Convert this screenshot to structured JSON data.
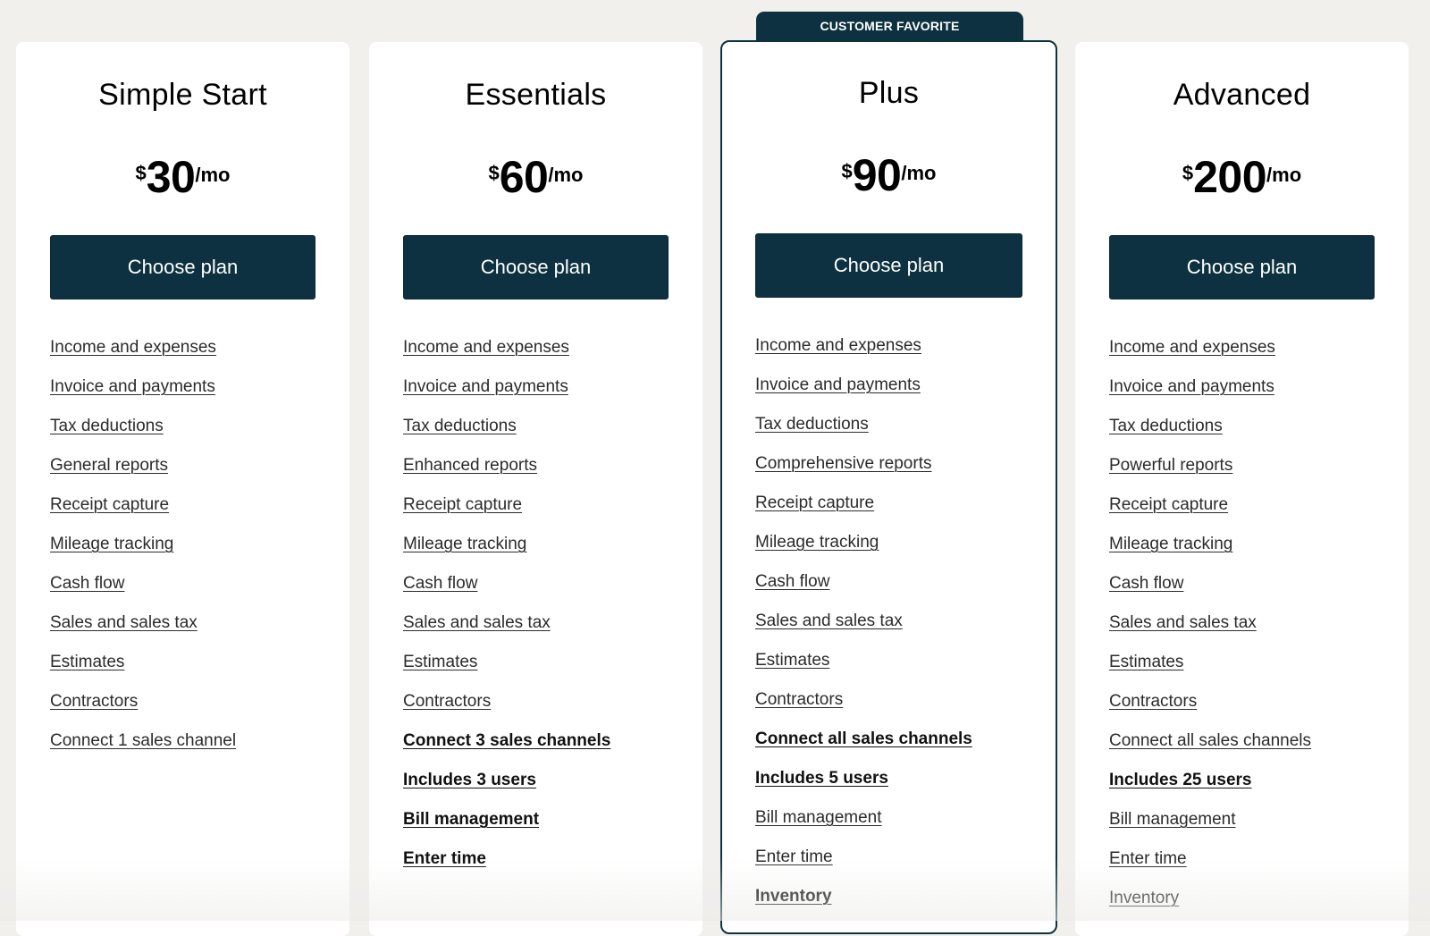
{
  "badge": {
    "label": "CUSTOMER FAVORITE",
    "plan_index": 2
  },
  "colors": {
    "accent": "#0d3140",
    "background": "#f2f0ed",
    "card": "#ffffff"
  },
  "plans": [
    {
      "name": "Simple Start",
      "price": {
        "currency": "$",
        "amount": "30",
        "period": "/mo"
      },
      "button_label": "Choose plan",
      "features": [
        {
          "label": "Income and expenses",
          "bold": false
        },
        {
          "label": "Invoice and payments",
          "bold": false
        },
        {
          "label": "Tax deductions",
          "bold": false
        },
        {
          "label": "General reports",
          "bold": false
        },
        {
          "label": "Receipt capture",
          "bold": false
        },
        {
          "label": "Mileage tracking",
          "bold": false
        },
        {
          "label": "Cash flow",
          "bold": false
        },
        {
          "label": "Sales and sales tax",
          "bold": false
        },
        {
          "label": "Estimates",
          "bold": false
        },
        {
          "label": "Contractors",
          "bold": false
        },
        {
          "label": "Connect 1 sales channel",
          "bold": false
        }
      ]
    },
    {
      "name": "Essentials",
      "price": {
        "currency": "$",
        "amount": "60",
        "period": "/mo"
      },
      "button_label": "Choose plan",
      "features": [
        {
          "label": "Income and expenses",
          "bold": false
        },
        {
          "label": "Invoice and payments",
          "bold": false
        },
        {
          "label": "Tax deductions",
          "bold": false
        },
        {
          "label": "Enhanced reports",
          "bold": false
        },
        {
          "label": "Receipt capture",
          "bold": false
        },
        {
          "label": "Mileage tracking",
          "bold": false
        },
        {
          "label": "Cash flow",
          "bold": false
        },
        {
          "label": "Sales and sales tax",
          "bold": false
        },
        {
          "label": "Estimates",
          "bold": false
        },
        {
          "label": "Contractors",
          "bold": false
        },
        {
          "label": "Connect 3 sales channels",
          "bold": true
        },
        {
          "label": "Includes 3 users",
          "bold": true
        },
        {
          "label": "Bill management",
          "bold": true
        },
        {
          "label": "Enter time",
          "bold": true
        }
      ]
    },
    {
      "name": "Plus",
      "price": {
        "currency": "$",
        "amount": "90",
        "period": "/mo"
      },
      "button_label": "Choose plan",
      "features": [
        {
          "label": "Income and expenses",
          "bold": false
        },
        {
          "label": "Invoice and payments",
          "bold": false
        },
        {
          "label": "Tax deductions",
          "bold": false
        },
        {
          "label": "Comprehensive reports",
          "bold": false
        },
        {
          "label": "Receipt capture",
          "bold": false
        },
        {
          "label": "Mileage tracking",
          "bold": false
        },
        {
          "label": "Cash flow",
          "bold": false
        },
        {
          "label": "Sales and sales tax",
          "bold": false
        },
        {
          "label": "Estimates",
          "bold": false
        },
        {
          "label": "Contractors",
          "bold": false
        },
        {
          "label": "Connect all sales channels",
          "bold": true
        },
        {
          "label": "Includes 5 users",
          "bold": true
        },
        {
          "label": "Bill management",
          "bold": false
        },
        {
          "label": "Enter time",
          "bold": false
        },
        {
          "label": "Inventory",
          "bold": true
        }
      ]
    },
    {
      "name": "Advanced",
      "price": {
        "currency": "$",
        "amount": "200",
        "period": "/mo"
      },
      "button_label": "Choose plan",
      "features": [
        {
          "label": "Income and expenses",
          "bold": false
        },
        {
          "label": "Invoice and payments",
          "bold": false
        },
        {
          "label": "Tax deductions",
          "bold": false
        },
        {
          "label": "Powerful reports",
          "bold": false
        },
        {
          "label": "Receipt capture",
          "bold": false
        },
        {
          "label": "Mileage tracking",
          "bold": false
        },
        {
          "label": "Cash flow",
          "bold": false
        },
        {
          "label": "Sales and sales tax",
          "bold": false
        },
        {
          "label": "Estimates",
          "bold": false
        },
        {
          "label": "Contractors",
          "bold": false
        },
        {
          "label": "Connect all sales channels",
          "bold": false
        },
        {
          "label": "Includes 25 users",
          "bold": true
        },
        {
          "label": "Bill management",
          "bold": false
        },
        {
          "label": "Enter time",
          "bold": false
        },
        {
          "label": "Inventory",
          "bold": false
        }
      ]
    }
  ]
}
